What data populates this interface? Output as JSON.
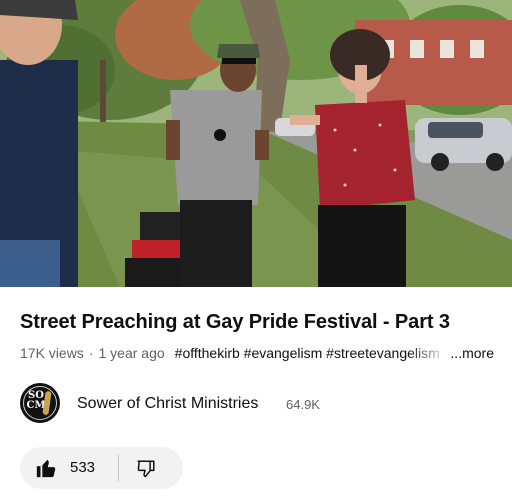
{
  "video": {
    "title": "Street Preaching at Gay Pride Festival - Part 3",
    "views": "17K views",
    "age": "1 year ago",
    "hashtags": "#offthekirb #evangelism #streetevangelism",
    "more_label": "...more"
  },
  "channel": {
    "name": "Sower of Christ Ministries",
    "subscribers": "64.9K",
    "avatar_text_top": "SO",
    "avatar_text_bottom": "CM"
  },
  "actions": {
    "like_count": "533",
    "like_icon": "thumbs-up-filled-icon",
    "dislike_icon": "thumbs-down-outline-icon"
  },
  "colors": {
    "background": "#ffffff",
    "text_primary": "#0f0f0f",
    "text_secondary": "#606060",
    "pill_background": "#f2f2f2"
  }
}
